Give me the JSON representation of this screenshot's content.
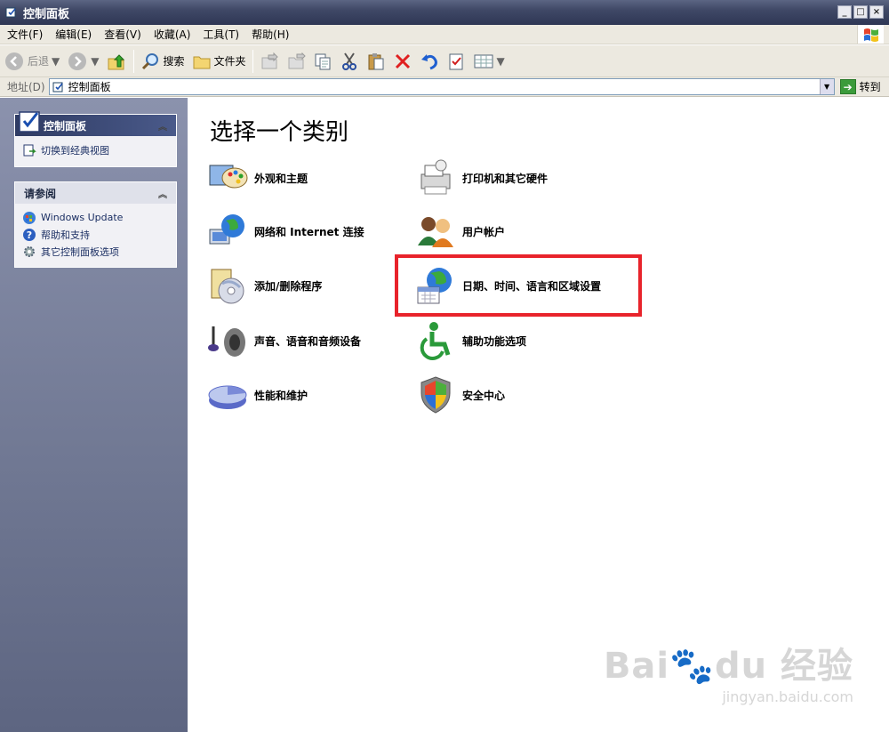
{
  "window": {
    "title": "控制面板"
  },
  "menu": [
    "文件(F)",
    "编辑(E)",
    "查看(V)",
    "收藏(A)",
    "工具(T)",
    "帮助(H)"
  ],
  "toolbar": {
    "back": "后退",
    "search": "搜索",
    "folders": "文件夹"
  },
  "address": {
    "label": "地址(D)",
    "value": "控制面板",
    "go": "转到"
  },
  "left": {
    "panel1": {
      "title": "控制面板",
      "switch_link": "切换到经典视图"
    },
    "panel2": {
      "title": "请参阅",
      "items": [
        "Windows Update",
        "帮助和支持",
        "其它控制面板选项"
      ]
    }
  },
  "main": {
    "title": "选择一个类别",
    "categories": [
      "外观和主题",
      "打印机和其它硬件",
      "网络和 Internet 连接",
      "用户帐户",
      "添加/删除程序",
      "日期、时间、语言和区域设置",
      "声音、语音和音频设备",
      "辅助功能选项",
      "性能和维护",
      "安全中心"
    ]
  },
  "watermark": {
    "brand": "Bai",
    "brand2": "du",
    "cn": "经验",
    "url": "jingyan.baidu.com"
  },
  "colors": {
    "highlight": "#e8232b",
    "title_bar": "#3f4866",
    "left_pane": "#6f7792"
  }
}
